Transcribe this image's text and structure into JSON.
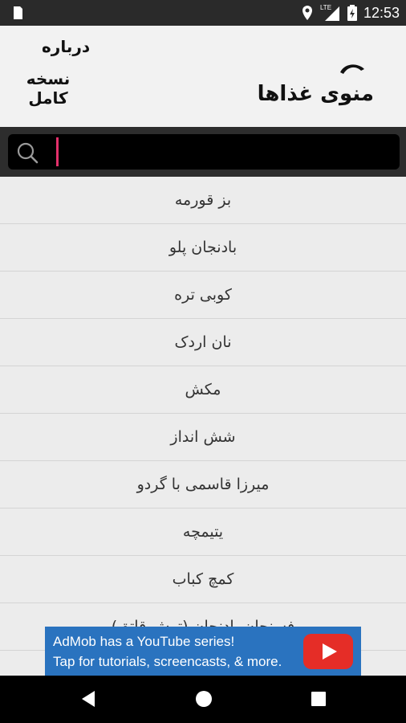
{
  "status_bar": {
    "time": "12:53",
    "network": "LTE",
    "icons": [
      "sd-card-icon",
      "location-icon",
      "signal-icon",
      "battery-icon"
    ]
  },
  "header": {
    "about_label": "درباره",
    "full_version_label": "نسخه کامل",
    "logo_text": "منوی غذاها"
  },
  "search": {
    "placeholder": "",
    "value": ""
  },
  "list": {
    "items": [
      "بز قورمه",
      "بادنجان پلو",
      "کوبی تره",
      "نان اردک",
      "مکش",
      "شش انداز",
      "میرزا قاسمی با گردو",
      "یتیمچه",
      "کمچ کباب",
      "فسنجان بادنجان (ترش قاتق)"
    ]
  },
  "ad": {
    "line1": "AdMob has a YouTube series!",
    "line2": "Tap for tutorials, screencasts, & more."
  },
  "colors": {
    "accent": "#e3306b",
    "ad_bg": "#2a73bf",
    "youtube_red": "#e52d27"
  }
}
